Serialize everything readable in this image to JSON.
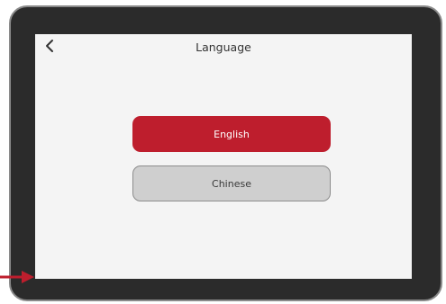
{
  "header": {
    "title": "Language",
    "back_icon": "chevron-left-icon"
  },
  "language_options": [
    {
      "label": "English",
      "selected": true
    },
    {
      "label": "Chinese",
      "selected": false
    }
  ],
  "colors": {
    "accent": "#be1e2d",
    "unselected": "#cfcfcf",
    "bezel": "#2b2b2b",
    "screen": "#f4f4f4"
  },
  "annotation": {
    "icon": "arrow-right-icon"
  }
}
